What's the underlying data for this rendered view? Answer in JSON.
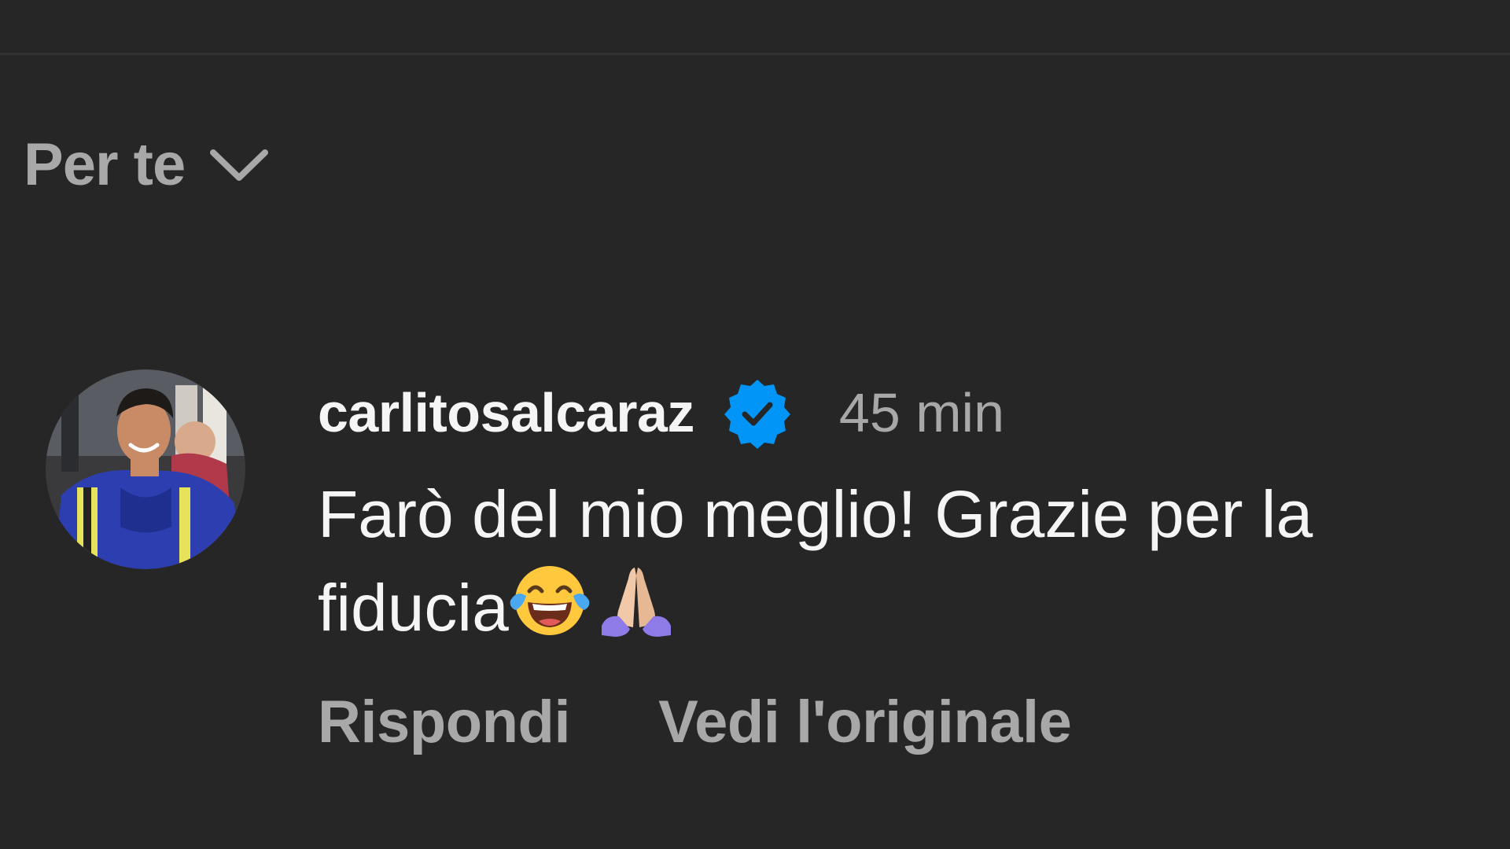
{
  "header": {
    "sort_label": "Per te",
    "sort_icon": "chevron-down-icon"
  },
  "comment": {
    "username": "carlitosalcaraz",
    "verified_icon": "verified-badge-icon",
    "timestamp": "45 min",
    "text": "Farò del mio meglio! Grazie per la fiducia",
    "emojis": [
      "face-with-tears-of-joy-emoji",
      "folded-hands-emoji"
    ],
    "actions": {
      "reply": "Rispondi",
      "see_original": "Vedi l'originale"
    }
  },
  "colors": {
    "background": "#262626",
    "primary_text": "#f5f5f5",
    "secondary_text": "#a8a8a8",
    "verified_blue": "#0095f6"
  }
}
